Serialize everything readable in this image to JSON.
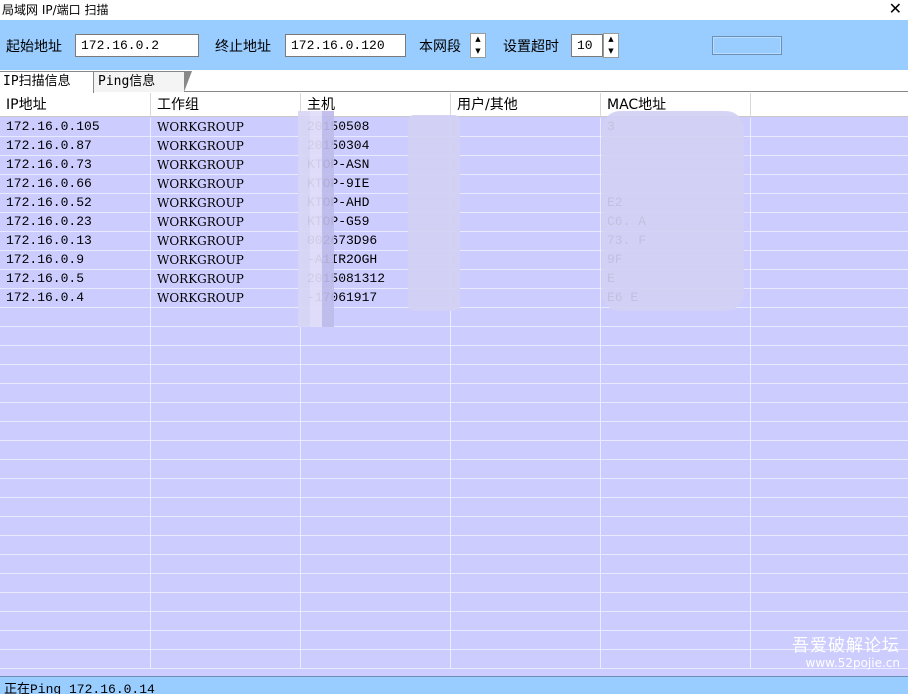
{
  "window": {
    "title": "局域网 IP/端口 扫描",
    "close_glyph": "✕"
  },
  "toolbar": {
    "start_label": "起始地址",
    "start_value": "172.16.0.2",
    "end_label": "终止地址",
    "end_value": "172.16.0.120",
    "subnet_label": "本网段",
    "timeout_label": "设置超时",
    "timeout_value": "10",
    "spin_up": "▲",
    "spin_down": "▼"
  },
  "tabs": [
    {
      "label": "IP扫描信息",
      "active": true
    },
    {
      "label": "Ping信息",
      "active": false
    }
  ],
  "table": {
    "columns": [
      "IP地址",
      "工作组",
      "主机",
      "用户/其他",
      "MAC地址"
    ],
    "rows": [
      {
        "ip": "172.16.0.105",
        "group": "WORKGROUP",
        "host": "20150508",
        "user": "",
        "mac": "3"
      },
      {
        "ip": "172.16.0.87",
        "group": "WORKGROUP",
        "host": "20150304",
        "user": "",
        "mac": ""
      },
      {
        "ip": "172.16.0.73",
        "group": "WORKGROUP",
        "host": "KTOP-ASN",
        "user": "",
        "mac": ""
      },
      {
        "ip": "172.16.0.66",
        "group": "WORKGROUP",
        "host": "KTOP-9IE",
        "user": "",
        "mac": ""
      },
      {
        "ip": "172.16.0.52",
        "group": "WORKGROUP",
        "host": "KTOP-AHD",
        "user": "",
        "mac": "E2"
      },
      {
        "ip": "172.16.0.23",
        "group": "WORKGROUP",
        "host": "KTOP-G59",
        "user": "",
        "mac": "C6.    A"
      },
      {
        "ip": "172.16.0.13",
        "group": "WORKGROUP",
        "host": "002673D96",
        "user": "",
        "mac": "73.    F"
      },
      {
        "ip": "172.16.0.9",
        "group": "WORKGROUP",
        "host": "-A1IR2OGH",
        "user": "",
        "mac": "9F"
      },
      {
        "ip": "172.16.0.5",
        "group": "WORKGROUP",
        "host": "2015081312",
        "user": "",
        "mac": "E"
      },
      {
        "ip": "172.16.0.4",
        "group": "WORKGROUP",
        "host": "-17061917",
        "user": "",
        "mac": "E6        E"
      }
    ]
  },
  "status": {
    "text": "正在Ping 172.16.0.14"
  },
  "watermark": {
    "line1": "吾爱破解论坛",
    "line2": "www.52pojie.cn"
  },
  "colors": {
    "toolbar": "#99ccff",
    "grid": "#ccccff",
    "status": "#99ccff"
  }
}
